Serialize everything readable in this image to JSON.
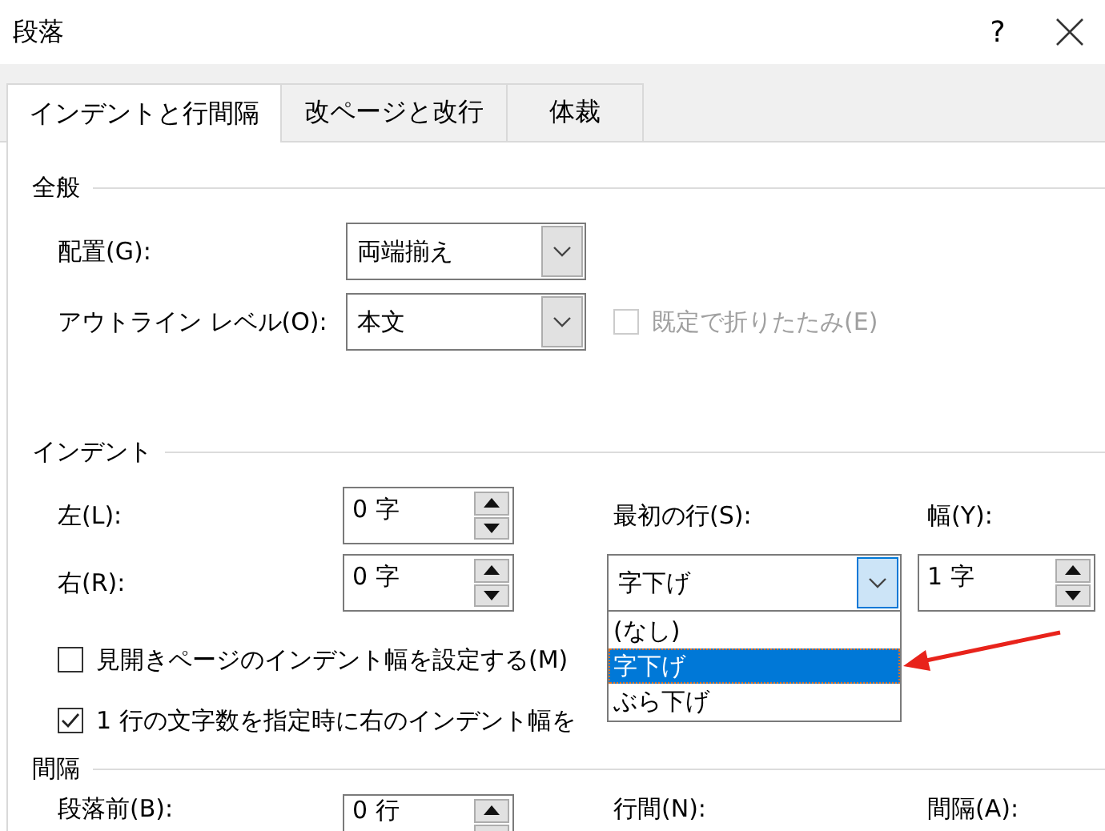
{
  "window": {
    "title": "段落",
    "help": "?"
  },
  "tabs": [
    {
      "label": "インデントと行間隔",
      "selected": true
    },
    {
      "label": "改ページと改行",
      "selected": false
    },
    {
      "label": "体裁",
      "selected": false
    }
  ],
  "general": {
    "heading": "全般",
    "alignment": {
      "label": "配置(G):",
      "value": "両端揃え"
    },
    "outline_level": {
      "label": "アウトライン レベル(O):",
      "value": "本文"
    },
    "collapse": {
      "label": "既定で折りたたみ(E)",
      "checked": false,
      "disabled": true
    }
  },
  "indent": {
    "heading": "インデント",
    "left": {
      "label": "左(L):",
      "value": "0 字"
    },
    "right": {
      "label": "右(R):",
      "value": "0 字"
    },
    "first_line": {
      "label": "最初の行(S):",
      "value": "字下げ",
      "expanded": true,
      "options": [
        {
          "label": "(なし)",
          "selected": false
        },
        {
          "label": "字下げ",
          "selected": true
        },
        {
          "label": "ぶら下げ",
          "selected": false
        }
      ]
    },
    "by": {
      "label": "幅(Y):",
      "value": "1 字"
    },
    "mirror": {
      "label": "見開きページのインデント幅を設定する(M)",
      "checked": false,
      "disabled": false
    },
    "auto_adjust": {
      "label": "1 行の文字数を指定時に右のインデント幅を",
      "checked": true,
      "disabled": false
    }
  },
  "spacing": {
    "heading": "間隔",
    "before": {
      "label": "段落前(B):",
      "value": "0 行"
    },
    "line_spacing": {
      "label": "行間(N):"
    },
    "at": {
      "label": "間隔(A):"
    }
  }
}
